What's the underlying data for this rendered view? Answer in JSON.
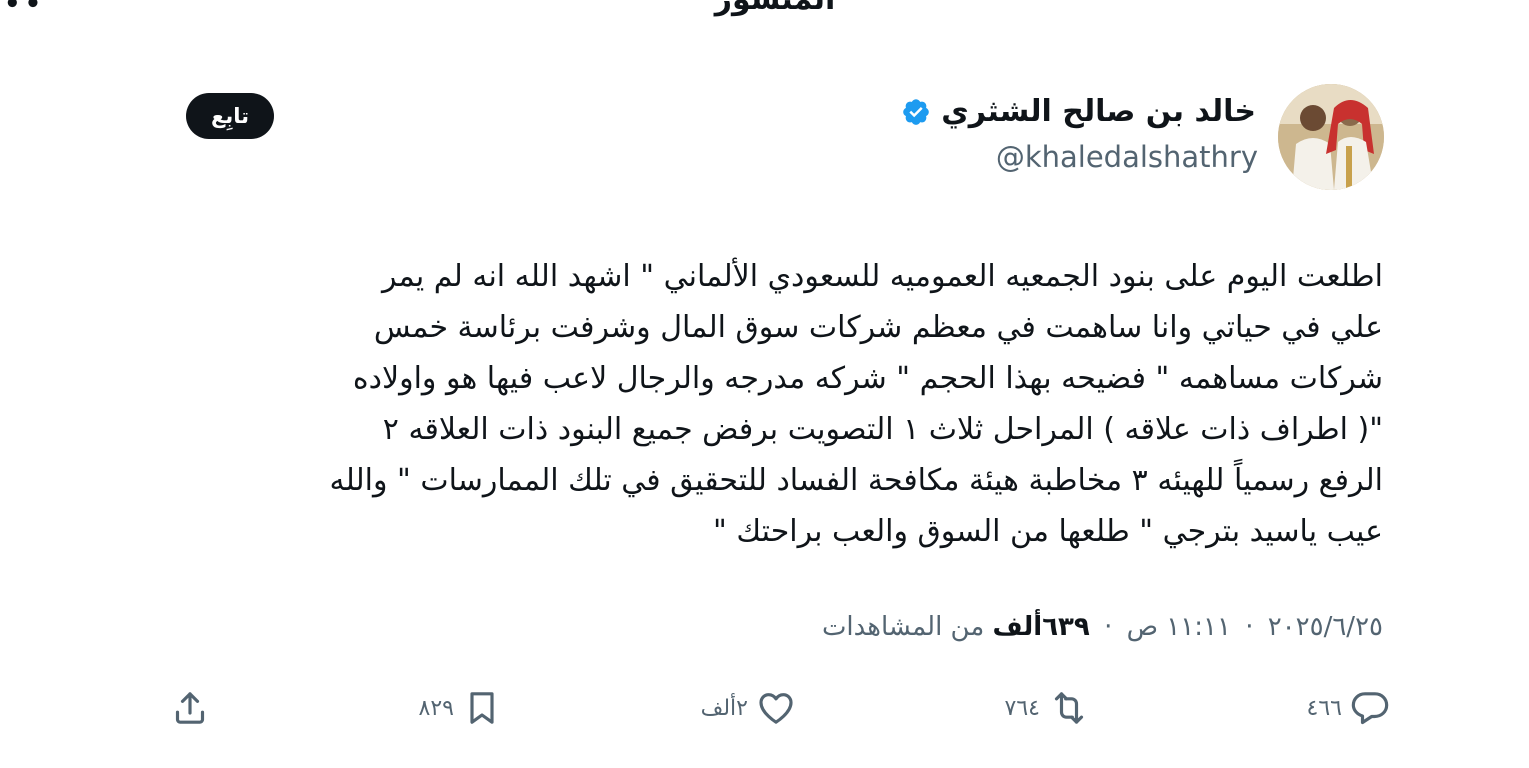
{
  "page": {
    "title": "المنشور"
  },
  "author": {
    "display_name": "خالد بن صالح الشثري",
    "handle": "@khaledalshathry",
    "verified": true,
    "follow_label": "تابِع"
  },
  "tweet": {
    "lines": [
      "اطلعت اليوم على بنود الجمعيه العموميه للسعودي الألماني \" اشهد الله انه لم يمر",
      "علي في حياتي وانا ساهمت في معظم شركات سوق المال وشرفت برئاسة خمس",
      "شركات مساهمه \" فضيحه بهذا الحجم \" شركه مدرجه والرجال لاعب فيها هو واولاده",
      "\"( اطراف ذات علاقه ) المراحل ثلاث ١ التصويت برفض جميع البنود   ذات العلاقه ٢",
      "الرفع رسمياً للهيئه ٣ مخاطبة هيئة مكافحة الفساد للتحقيق في تلك الممارسات \" والله",
      "عيب ياسيد بترجي \" طلعها من السوق والعب براحتك \""
    ]
  },
  "meta": {
    "time": "١١:١١ ص",
    "date": "٢٠٢٥/٦/٢٥",
    "separator": "·",
    "views_count": "٦٣٩ألف",
    "views_label": "من المشاهدات"
  },
  "actions": {
    "replies": "٤٦٦",
    "reposts": "٧٦٤",
    "likes": "٢ألف",
    "bookmarks": "٨٢٩"
  },
  "colors": {
    "text_primary": "#0f1419",
    "text_secondary": "#536471",
    "verified_blue": "#1d9bf0",
    "follow_button_bg": "#0f1419"
  },
  "icons": [
    "more-icon",
    "verified-badge-icon",
    "reply-icon",
    "repost-icon",
    "like-icon",
    "bookmark-icon",
    "share-icon"
  ]
}
